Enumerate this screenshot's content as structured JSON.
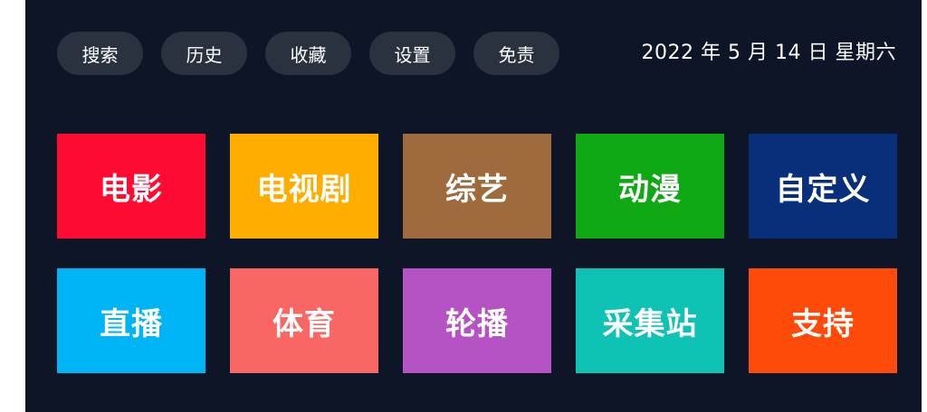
{
  "topbar": {
    "buttons": [
      "搜索",
      "历史",
      "收藏",
      "设置",
      "免责"
    ]
  },
  "date_text": "2022 年 5 月 14 日 星期六",
  "tiles": [
    {
      "label": "电影",
      "color": "#ff0a32"
    },
    {
      "label": "电视剧",
      "color": "#ffae00"
    },
    {
      "label": "综艺",
      "color": "#9f6a3e"
    },
    {
      "label": "动漫",
      "color": "#10a814"
    },
    {
      "label": "自定义",
      "color": "#0a2f7a"
    },
    {
      "label": "直播",
      "color": "#00b5f5"
    },
    {
      "label": "体育",
      "color": "#f86763"
    },
    {
      "label": "轮播",
      "color": "#b552c4"
    },
    {
      "label": "采集站",
      "color": "#0ec2b4"
    },
    {
      "label": "支持",
      "color": "#ff4b0a"
    }
  ]
}
